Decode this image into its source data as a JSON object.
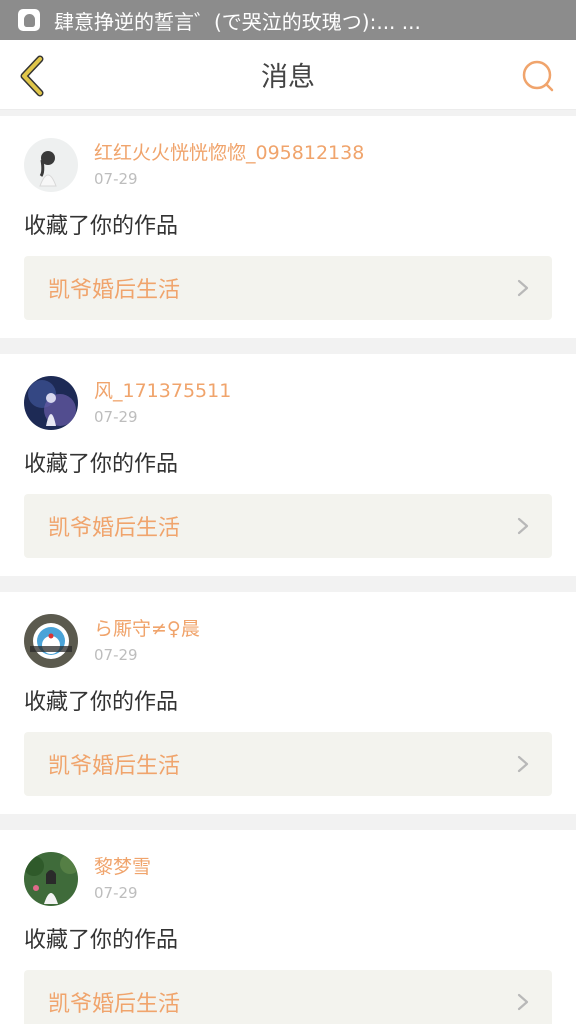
{
  "statusbar": {
    "notification_text": "肆意挣逆的誓言゛(で哭泣的玫瑰つ):... ..."
  },
  "header": {
    "title": "消息"
  },
  "colors": {
    "accent": "#f0a46c",
    "back_icon": "#e0c64a"
  },
  "messages": [
    {
      "user": "红红火火恍恍惚惚_095812138",
      "date": "07-29",
      "action": "收藏了你的作品",
      "work_title": "凯爷婚后生活"
    },
    {
      "user": "风_171375511",
      "date": "07-29",
      "action": "收藏了你的作品",
      "work_title": "凯爷婚后生活"
    },
    {
      "user": "ら厮守≠♀晨",
      "date": "07-29",
      "action": "收藏了你的作品",
      "work_title": "凯爷婚后生活"
    },
    {
      "user": "黎梦雪",
      "date": "07-29",
      "action": "收藏了你的作品",
      "work_title": "凯爷婚后生活"
    }
  ]
}
